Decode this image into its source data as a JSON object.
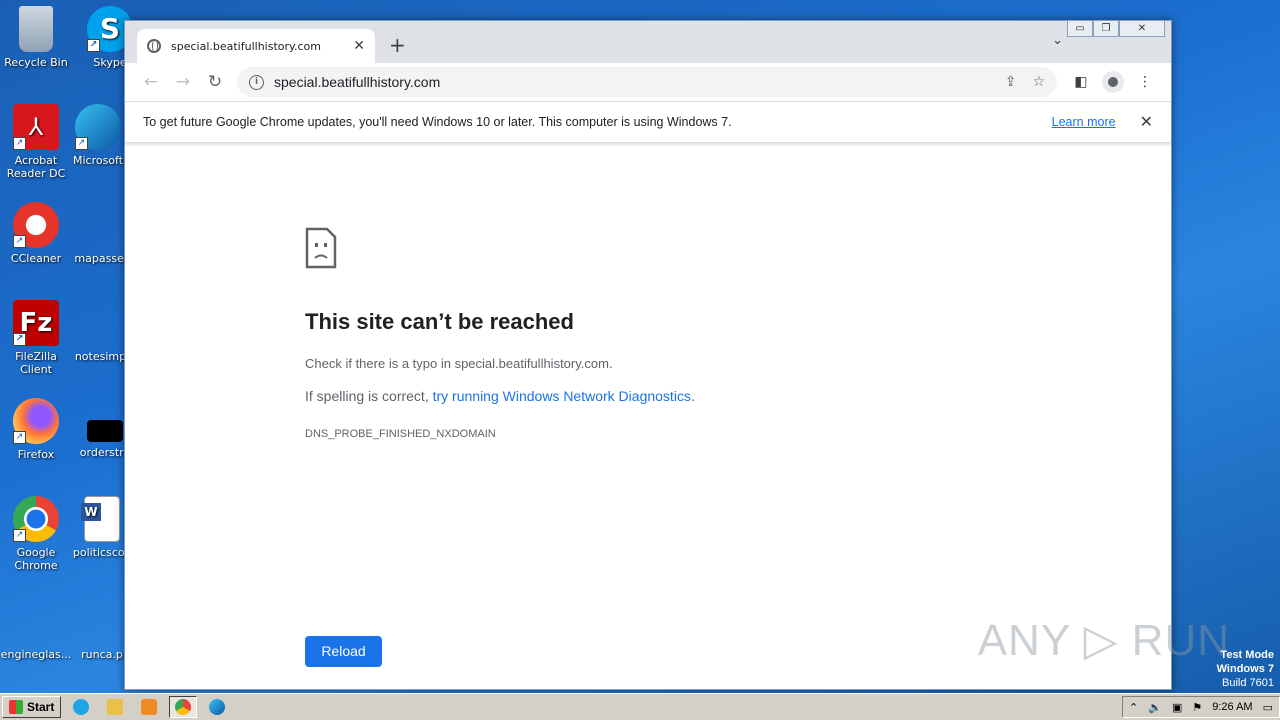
{
  "desktop": {
    "icons": [
      {
        "label": "Recycle Bin"
      },
      {
        "label": "Skype"
      },
      {
        "label": "Acrobat Reader DC"
      },
      {
        "label": "Microsoft"
      },
      {
        "label": "CCleaner"
      },
      {
        "label": "mapasses"
      },
      {
        "label": "FileZilla Client"
      },
      {
        "label": "notesimpl"
      },
      {
        "label": "Firefox"
      },
      {
        "label": "orderstro"
      },
      {
        "label": "Google Chrome"
      },
      {
        "label": "politicscov"
      },
      {
        "label": "engineglas..."
      },
      {
        "label": "runca.p"
      }
    ]
  },
  "browser": {
    "tab": {
      "title": "special.beatifullhistory.com",
      "close": "✕"
    },
    "new_tab": "+",
    "tab_search": "⌄",
    "window_controls": {
      "minimize": "▭",
      "restore": "❐",
      "close": "✕"
    },
    "toolbar": {
      "back": "←",
      "forward": "→",
      "reload": "↻",
      "url": "special.beatifullhistory.com",
      "info_icon": "i",
      "share_icon": "⇪",
      "star_icon": "☆",
      "sidepanel_icon": "◧",
      "menu_icon": "⋮"
    },
    "infobar": {
      "message": "To get future Google Chrome updates, you'll need Windows 10 or later. This computer is using Windows 7.",
      "link": "Learn more",
      "close": "✕"
    }
  },
  "error": {
    "title": "This site can’t be reached",
    "line1": "Check if there is a typo in special.beatifullhistory.com.",
    "line2_prefix": "If spelling is correct, ",
    "line2_link": "try running Windows Network Diagnostics",
    "line2_suffix": ".",
    "code": "DNS_PROBE_FINISHED_NXDOMAIN",
    "reload_button": "Reload"
  },
  "watermark": "ANY ▷ RUN",
  "os_info": {
    "line1": "Test Mode",
    "line2": "Windows 7",
    "line3": "Build 7601"
  },
  "taskbar": {
    "start_label": "Start",
    "clock": "9:26 AM",
    "tray_icons": [
      "⌃",
      "🔈",
      "▣",
      "⚑",
      "▭"
    ]
  }
}
